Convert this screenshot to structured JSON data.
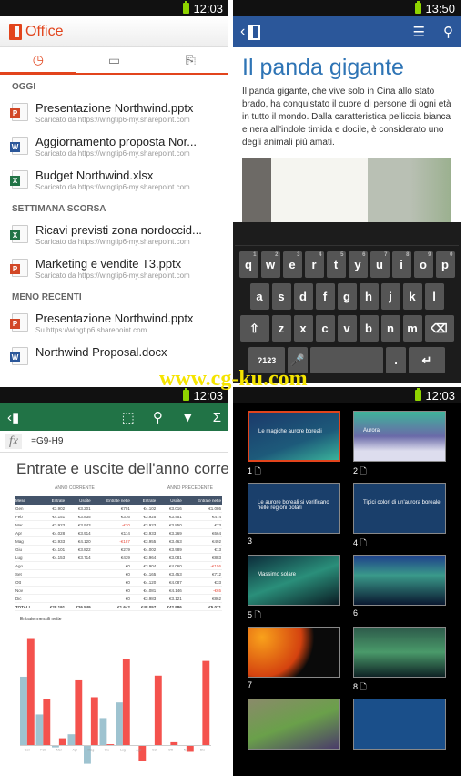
{
  "q1": {
    "time": "12:03",
    "app": "Office",
    "tabs": [
      "recent",
      "open",
      "new"
    ],
    "sections": [
      {
        "title": "OGGI",
        "files": [
          {
            "name": "Presentazione Northwind.pptx",
            "sub": "Scaricato da https://wingtip6-my.sharepoint.com",
            "type": "P",
            "color": "#d24726"
          },
          {
            "name": "Aggiornamento proposta Nor...",
            "sub": "Scaricato da https://wingtip6-my.sharepoint.com",
            "type": "W",
            "color": "#2b579a"
          },
          {
            "name": "Budget Northwind.xlsx",
            "sub": "Scaricato da https://wingtip6-my.sharepoint.com",
            "type": "X",
            "color": "#217346"
          }
        ]
      },
      {
        "title": "SETTIMANA SCORSA",
        "files": [
          {
            "name": "Ricavi previsti zona nordoccid...",
            "sub": "Scaricato da https://wingtip6-my.sharepoint.com",
            "type": "X",
            "color": "#217346"
          },
          {
            "name": "Marketing e vendite T3.pptx",
            "sub": "Scaricato da https://wingtip6-my.sharepoint.com",
            "type": "P",
            "color": "#d24726"
          }
        ]
      },
      {
        "title": "MENO RECENTI",
        "files": [
          {
            "name": "Presentazione Northwind.pptx",
            "sub": "Su https://wingtip6.sharepoint.com",
            "type": "P",
            "color": "#d24726"
          },
          {
            "name": "Northwind Proposal.docx",
            "sub": "",
            "type": "W",
            "color": "#2b579a"
          }
        ]
      }
    ]
  },
  "q2": {
    "time": "13:50",
    "title": "Il panda gigante",
    "body": "Il panda gigante, che vive solo in Cina allo stato brado, ha conquistato il cuore di persone di ogni età in tutto il mondo. Dalla caratteristica pelliccia bianca e nera all'indole timida e docile, è considerato uno degli animali più amati.",
    "keys": [
      [
        "q",
        "w",
        "e",
        "r",
        "t",
        "y",
        "u",
        "i",
        "o",
        "p"
      ],
      [
        "a",
        "s",
        "d",
        "f",
        "g",
        "h",
        "j",
        "k",
        "l"
      ],
      [
        "⇧",
        "z",
        "x",
        "c",
        "v",
        "b",
        "n",
        "m",
        "⌫"
      ],
      [
        "?123",
        "🎤",
        " ",
        ".",
        "↵"
      ]
    ],
    "nums": [
      "1",
      "2",
      "3",
      "4",
      "5",
      "6",
      "7",
      "8",
      "9",
      "0"
    ]
  },
  "q3": {
    "time": "12:03",
    "formula": "=G9-H9",
    "fx": "fx",
    "title": "Entrate e uscite dell'anno corre",
    "anno_corrente": "ANNO CORRENTE",
    "anno_precedente": "ANNO PRECEDENTE",
    "headers": [
      "Mese",
      "Entrate",
      "Uscite",
      "Entrate nette",
      "Entrate",
      "Uscite",
      "Entrate nette"
    ],
    "rows": [
      [
        "Gen",
        "€3.902",
        "€3.201",
        "€701",
        "€4.102",
        "€3.016",
        "€1.086"
      ],
      [
        "Feb",
        "€4.151",
        "€3.835",
        "€316",
        "€3.925",
        "€3.451",
        "€474"
      ],
      [
        "Mar",
        "€3.923",
        "€3.943",
        "-€20",
        "€3.923",
        "€3.850",
        "€73"
      ],
      [
        "Apr",
        "€4.028",
        "€3.914",
        "€114",
        "€3.933",
        "€3.269",
        "€664"
      ],
      [
        "Mag",
        "€3.933",
        "€4.120",
        "-€187",
        "€3.955",
        "€3.463",
        "€492"
      ],
      [
        "Giu",
        "€4.101",
        "€3.822",
        "€279",
        "€4.002",
        "€3.989",
        "€13"
      ],
      [
        "Lug",
        "€4.153",
        "€3.714",
        "€439",
        "€3.964",
        "€3.081",
        "€883"
      ],
      [
        "Ago",
        "",
        "",
        "€0",
        "€3.904",
        "€4.060",
        "-€156"
      ],
      [
        "Set",
        "",
        "",
        "€0",
        "€4.165",
        "€3.453",
        "€712"
      ],
      [
        "Ott",
        "",
        "",
        "€0",
        "€4.120",
        "€4.087",
        "€33"
      ],
      [
        "Nov",
        "",
        "",
        "€0",
        "€4.081",
        "€4.146",
        "-€65"
      ],
      [
        "Dic",
        "",
        "",
        "€0",
        "€3.983",
        "€3.121",
        "€862"
      ]
    ],
    "total": [
      "TOTALI",
      "€28.191",
      "€26.549",
      "€1.642",
      "€48.057",
      "€42.986",
      "€5.071"
    ],
    "chart_data": {
      "type": "bar",
      "title": "Entrate mensili nette",
      "categories": [
        "Gen",
        "Feb",
        "Mar",
        "Apr",
        "Mag",
        "Giu",
        "Lug",
        "Ago",
        "Set",
        "Ott",
        "Nov",
        "Dic"
      ],
      "series": [
        {
          "name": "Anno corrente",
          "color": "#9ec3d0",
          "values": [
            701,
            316,
            -20,
            114,
            -187,
            279,
            439,
            0,
            0,
            0,
            0,
            0
          ]
        },
        {
          "name": "Anno precedente",
          "color": "#f4524d",
          "values": [
            1086,
            474,
            73,
            664,
            492,
            13,
            883,
            -156,
            712,
            33,
            -65,
            862
          ]
        }
      ],
      "ylim": [
        -200,
        1100
      ]
    }
  },
  "q4": {
    "time": "12:03",
    "slides": [
      {
        "n": "1",
        "note": true,
        "text": "Le magiche aurore boreali",
        "bg": "linear-gradient(160deg,#1b3a6b,#1d5a7a 60%,#3ab39a)",
        "sel": true
      },
      {
        "n": "2",
        "note": true,
        "text": "Aurora",
        "bg": "linear-gradient(180deg,#3fb39a,#6a6aa8 50%,#dde 80%)"
      },
      {
        "n": "3",
        "note": false,
        "text": "Le aurore boreali si verificano nelle regioni polari",
        "bg": "#1a3f6b"
      },
      {
        "n": "4",
        "note": true,
        "text": "Tipici colori di un'aurora boreale",
        "bg": "#1a3f6b"
      },
      {
        "n": "5",
        "note": true,
        "text": "Massimo solare",
        "bg": "linear-gradient(160deg,#0c2b3a,#2a8f7a 50%,#0a1a22)"
      },
      {
        "n": "6",
        "note": false,
        "text": "",
        "bg": "linear-gradient(180deg,#1e3f8a,#3a9a8a 40%,#0a1830)"
      },
      {
        "n": "7",
        "note": false,
        "text": "",
        "bg": "radial-gradient(circle at 15% 20%,#f9a21b 0,#d4420f 45%,#0a0a0a 60%)"
      },
      {
        "n": "8",
        "note": true,
        "text": "",
        "bg": "linear-gradient(180deg,#2d5a4a,#4a9a6a 50%,#0e2224)"
      },
      {
        "n": "",
        "note": false,
        "text": "",
        "bg": "linear-gradient(160deg,#8a8a6a,#6aa04a 50%,#4a3a6a)"
      },
      {
        "n": "",
        "note": false,
        "text": "",
        "bg": "#1a4f8a"
      }
    ]
  },
  "watermark": "www.cg-ku.com"
}
